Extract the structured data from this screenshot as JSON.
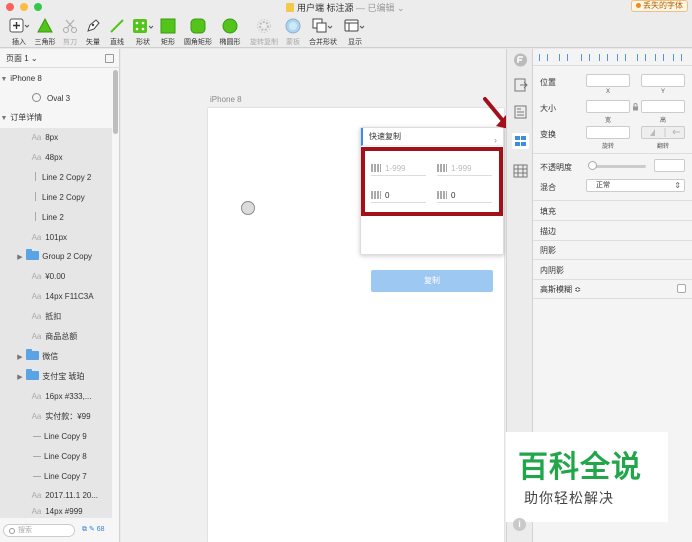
{
  "window": {
    "title": "用户端 标注源",
    "subtitle": "— 已编辑 ⌄",
    "missing_font": "丢失的字体"
  },
  "toolbar": [
    {
      "name": "insert",
      "label": "插入"
    },
    {
      "name": "triangle",
      "label": "三角形"
    },
    {
      "name": "scissors",
      "label": "剪刀"
    },
    {
      "name": "vector",
      "label": "矢量"
    },
    {
      "name": "line",
      "label": "直线"
    },
    {
      "name": "shape",
      "label": "形状"
    },
    {
      "name": "rect",
      "label": "矩形"
    },
    {
      "name": "rounded-rect",
      "label": "圆角矩形"
    },
    {
      "name": "oval",
      "label": "椭圆形"
    },
    {
      "name": "rotate-copy",
      "label": "旋转复制"
    },
    {
      "name": "mask",
      "label": "蒙板"
    },
    {
      "name": "combine",
      "label": "合并形状"
    },
    {
      "name": "view",
      "label": "显示"
    }
  ],
  "layers": {
    "page": "页面 1 ⌄",
    "search_placeholder": "搜索",
    "footer_count": "68",
    "items": [
      {
        "prefix": "▼",
        "kind": "group",
        "label": "iPhone 8"
      },
      {
        "prefix": "",
        "kind": "oval",
        "label": "Oval 3"
      },
      {
        "prefix": "▼",
        "kind": "group",
        "label": "订单详情"
      },
      {
        "prefix": "Aa",
        "kind": "text",
        "label": "8px"
      },
      {
        "prefix": "Aa",
        "kind": "text",
        "label": "48px"
      },
      {
        "prefix": "",
        "kind": "vline",
        "label": "Line 2 Copy 2"
      },
      {
        "prefix": "",
        "kind": "vline",
        "label": "Line 2 Copy"
      },
      {
        "prefix": "",
        "kind": "vline",
        "label": "Line 2"
      },
      {
        "prefix": "Aa",
        "kind": "text",
        "label": "101px"
      },
      {
        "prefix": "▶",
        "kind": "folder",
        "label": "Group 2 Copy"
      },
      {
        "prefix": "Aa",
        "kind": "text",
        "label": "¥0.00"
      },
      {
        "prefix": "Aa",
        "kind": "text",
        "label": "14px F11C3A"
      },
      {
        "prefix": "Aa",
        "kind": "text",
        "label": "抵扣"
      },
      {
        "prefix": "Aa",
        "kind": "text",
        "label": "商品总额"
      },
      {
        "prefix": "▶",
        "kind": "folder",
        "label": "微信"
      },
      {
        "prefix": "▶",
        "kind": "folder",
        "label": "支付宝 琥珀"
      },
      {
        "prefix": "Aa",
        "kind": "text",
        "label": "16px #333,..."
      },
      {
        "prefix": "Aa",
        "kind": "text",
        "label": "实付款：¥99"
      },
      {
        "prefix": "",
        "kind": "hline",
        "label": "Line Copy 9"
      },
      {
        "prefix": "",
        "kind": "hline",
        "label": "Line Copy 8"
      },
      {
        "prefix": "",
        "kind": "hline",
        "label": "Line Copy 7"
      },
      {
        "prefix": "Aa",
        "kind": "text",
        "label": "2017.11.1 20..."
      },
      {
        "prefix": "Aa",
        "kind": "text",
        "label": "14px #999"
      }
    ]
  },
  "canvas": {
    "artboard_label": "iPhone 8"
  },
  "quick_copy": {
    "title": "快速复制",
    "chevron": "›",
    "fields": [
      {
        "value": "1-999",
        "placeholder": true
      },
      {
        "value": "1-999",
        "placeholder": true
      },
      {
        "value": "0",
        "placeholder": false
      },
      {
        "value": "0",
        "placeholder": false
      }
    ],
    "button": "复制"
  },
  "inspector": {
    "position": "位置",
    "x": "X",
    "y": "Y",
    "size": "大小",
    "width": "宽",
    "height": "高",
    "transform": "变换",
    "rotate": "旋转",
    "flip": "翻转",
    "opacity": "不透明度",
    "blend": "混合",
    "blend_value": "正常",
    "fill": "填充",
    "border": "描边",
    "shadow": "阴影",
    "inner_shadow": "内阴影",
    "blur": "高斯模糊 ≎"
  },
  "watermark": {
    "title": "百科全说",
    "subtitle": "助你轻松解决"
  },
  "colors": {
    "accent": "#3d8de0",
    "highlight": "#a2101a",
    "brand": "#22a64a",
    "tool_green": "#52c41a"
  }
}
